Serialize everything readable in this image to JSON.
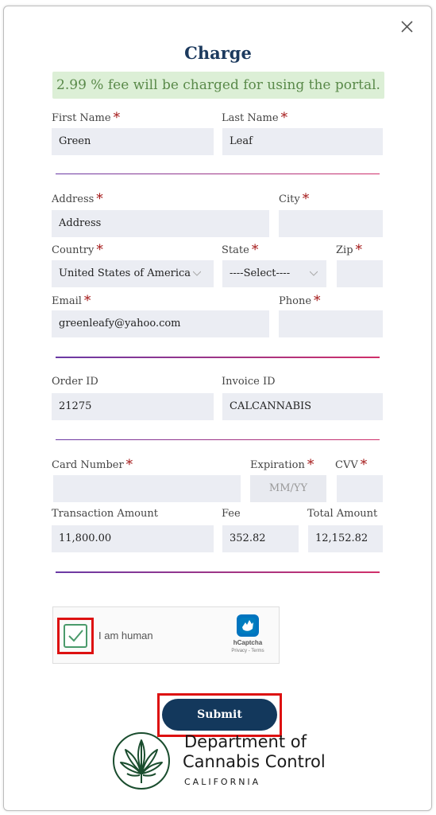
{
  "form": {
    "title": "Charge",
    "fee_notice": "2.99 % fee will be charged for using the portal.",
    "first_name": {
      "label": "First Name",
      "value": "Green"
    },
    "last_name": {
      "label": "Last Name",
      "value": "Leaf"
    },
    "address": {
      "label": "Address",
      "value": "Address"
    },
    "city": {
      "label": "City",
      "value": ""
    },
    "country": {
      "label": "Country",
      "value": "United States of America"
    },
    "state": {
      "label": "State",
      "value": "----Select----"
    },
    "zip": {
      "label": "Zip",
      "value": ""
    },
    "email": {
      "label": "Email",
      "value": "greenleafy@yahoo.com"
    },
    "phone": {
      "label": "Phone",
      "value": ""
    },
    "order_id": {
      "label": "Order ID",
      "value": "21275"
    },
    "invoice_id": {
      "label": "Invoice ID",
      "value": "CALCANNABIS"
    },
    "card_number": {
      "label": "Card Number",
      "value": ""
    },
    "expiration": {
      "label": "Expiration",
      "placeholder": "MM/YY"
    },
    "cvv": {
      "label": "CVV",
      "value": ""
    },
    "transaction_amount": {
      "label": "Transaction Amount",
      "value": "11,800.00"
    },
    "fee": {
      "label": "Fee",
      "value": "352.82"
    },
    "total_amount": {
      "label": "Total Amount",
      "value": "12,152.82"
    },
    "required_mark": "*"
  },
  "captcha": {
    "checkbox_label": "I am human",
    "checked": true,
    "brand": "hCaptcha",
    "links": "Privacy - Terms"
  },
  "submit_label": "Submit",
  "footer": {
    "line1": "Department of",
    "line2": "Cannabis Control",
    "line3": "CALIFORNIA"
  },
  "icons": {
    "close": "close-icon",
    "select_chevron": "chevron-down-icon",
    "checkmark": "check-icon",
    "captcha_logo": "hcaptcha-logo-icon",
    "agency_logo": "cannabis-leaf-logo-icon"
  },
  "colors": {
    "title": "#1c3a5e",
    "banner_bg": "#dcefd6",
    "banner_text": "#5a8a4a",
    "required": "#a31515",
    "submit_bg": "#13385c",
    "highlight": "#dd1111",
    "check": "#4a9a6b"
  }
}
